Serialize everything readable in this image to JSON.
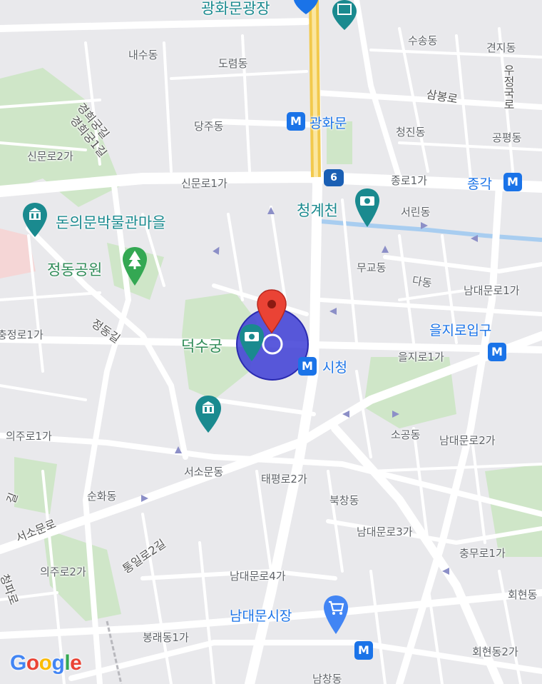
{
  "map": {
    "area_labels": [
      {
        "id": "naesu",
        "text": "내수동"
      },
      {
        "id": "doryeom",
        "text": "도렴동"
      },
      {
        "id": "susong",
        "text": "수송동"
      },
      {
        "id": "gyeonji",
        "text": "견지동"
      },
      {
        "id": "dangju",
        "text": "당주동"
      },
      {
        "id": "cheongjin",
        "text": "청진동"
      },
      {
        "id": "gongpyeong",
        "text": "공평동"
      },
      {
        "id": "sinmunro2",
        "text": "신문로2가"
      },
      {
        "id": "sinmunro1",
        "text": "신문로1가"
      },
      {
        "id": "jongno1",
        "text": "종로1가"
      },
      {
        "id": "seorin",
        "text": "서린동"
      },
      {
        "id": "mugyo",
        "text": "무교동"
      },
      {
        "id": "dadong",
        "text": "다동"
      },
      {
        "id": "namdaemunro1",
        "text": "남대문로1가"
      },
      {
        "id": "chungjeongro1",
        "text": "충정로1가"
      },
      {
        "id": "euljiro1",
        "text": "을지로1가"
      },
      {
        "id": "uijuro1",
        "text": "의주로1가"
      },
      {
        "id": "sogong",
        "text": "소공동"
      },
      {
        "id": "namdaemunro2",
        "text": "남대문로2가"
      },
      {
        "id": "seosomun",
        "text": "서소문동"
      },
      {
        "id": "taepyeongro2",
        "text": "태평로2가"
      },
      {
        "id": "sunhwa",
        "text": "순화동"
      },
      {
        "id": "bukchang",
        "text": "북창동"
      },
      {
        "id": "namdaemunro3",
        "text": "남대문로3가"
      },
      {
        "id": "chungmuro1",
        "text": "충무로1가"
      },
      {
        "id": "uijuro2",
        "text": "의주로2가"
      },
      {
        "id": "namdaemunro4",
        "text": "남대문로4가"
      },
      {
        "id": "hoehyeon",
        "text": "회현동"
      },
      {
        "id": "bongnae1",
        "text": "봉래동1가"
      },
      {
        "id": "hoehyeon2",
        "text": "회현동2가"
      },
      {
        "id": "namchang",
        "text": "남창동"
      }
    ],
    "road_labels": [
      {
        "id": "gyeonghuigung",
        "text": "경희궁길"
      },
      {
        "id": "gyeonghuigung1",
        "text": "경희궁1길"
      },
      {
        "id": "sambongro",
        "text": "삼봉로"
      },
      {
        "id": "ujeongguk",
        "text": "우정국로"
      },
      {
        "id": "jeongdong",
        "text": "정동길"
      },
      {
        "id": "seosomunro",
        "text": "서소문로"
      },
      {
        "id": "tongilro2",
        "text": "통일로2길"
      },
      {
        "id": "cheongparo",
        "text": "청파로"
      },
      {
        "id": "gil",
        "text": "길"
      }
    ],
    "poi_labels": {
      "gwanghwamun_plaza": "광화문광장",
      "doneuimun": "돈의문박물관마을",
      "jeongdong_park": "정동공원",
      "cheonggyecheon": "청계천",
      "deoksugung": "덕수궁",
      "namdaemun_market": "남대문시장"
    },
    "metro_stations": {
      "gwanghwamun": "광화문",
      "jonggak": "종각",
      "euljiro_ipgu": "을지로입구",
      "city_hall": "시청"
    },
    "metro_symbol": "M",
    "route_badge": "6",
    "attribution": "Google",
    "colors": {
      "map_bg": "#e9e9ec",
      "block": "#dcdce0",
      "road": "#ffffff",
      "major_road": "#f6d860",
      "park": "#cfe6c8",
      "water": "#a8cdf0",
      "metro": "#1a73e8",
      "pin": "#ea4335",
      "accuracy_circle": "#3d3dd6"
    },
    "icons": [
      "museum-icon",
      "camera-icon",
      "tree-icon",
      "shopping-cart-icon",
      "location-pin-icon",
      "metro-icon"
    ]
  }
}
